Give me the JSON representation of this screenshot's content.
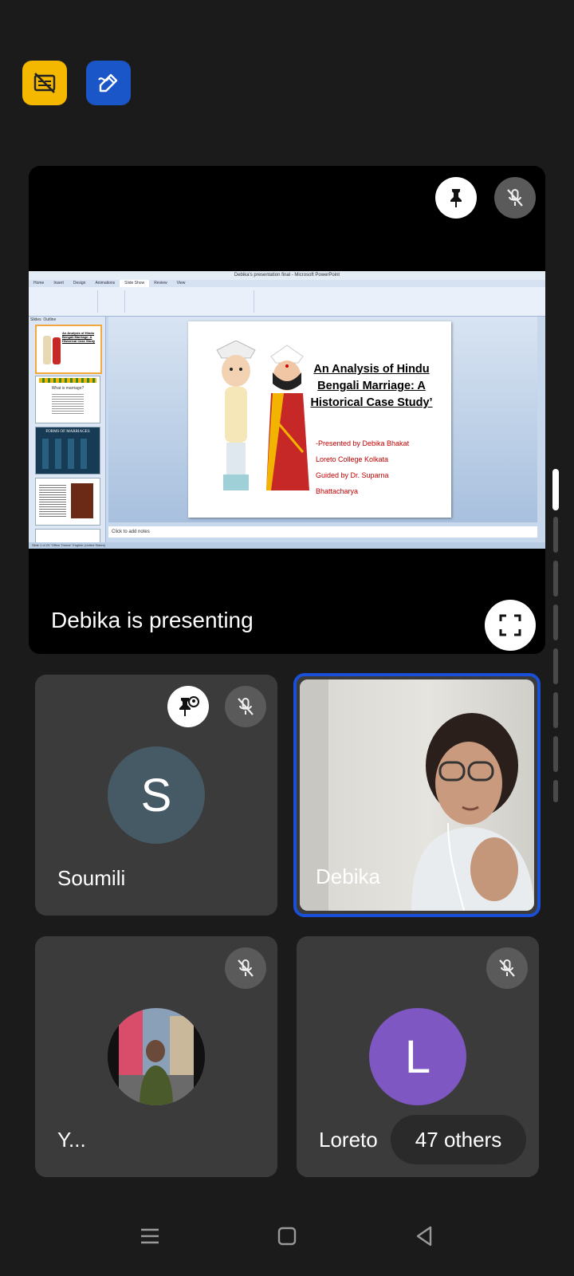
{
  "toolbar": {
    "captions_icon": "captions-off-icon",
    "edit_icon": "annotate-icon"
  },
  "presentation": {
    "presenting_label": "Debika is presenting",
    "ppt": {
      "window_title": "Debika's presentation final - Microsoft PowerPoint",
      "tabs": [
        "Home",
        "Insert",
        "Design",
        "Animations",
        "Slide Show",
        "Review",
        "View"
      ],
      "panel_tabs": [
        "Slides",
        "Outline"
      ],
      "notes_placeholder": "Click to add notes",
      "status": "Slide 1 of 23    \"Office Theme\"    English (United States)",
      "slide": {
        "title": "An Analysis of Hindu Bengali Marriage: A Historical Case Study’",
        "lines": [
          "-Presented by Debika Bhakat",
          "Loreto College Kolkata",
          "Guided by Dr. Suparna",
          "Bhattacharya"
        ]
      },
      "thumbnails": [
        {
          "label": "An Analysis of Hindu Bengali Marriage: A Historical Case Study"
        },
        {
          "label": "What is marriage?"
        },
        {
          "label": "FORMS OF MARRIAGES"
        },
        {
          "label": ""
        }
      ]
    }
  },
  "participants": [
    {
      "name": "Soumili",
      "initial": "S",
      "color": "#455a64"
    },
    {
      "name": "Debika"
    },
    {
      "name": "Y..."
    },
    {
      "name": "Loreto",
      "initial": "L",
      "color": "#7e57c2"
    }
  ],
  "others_label": "47 others"
}
